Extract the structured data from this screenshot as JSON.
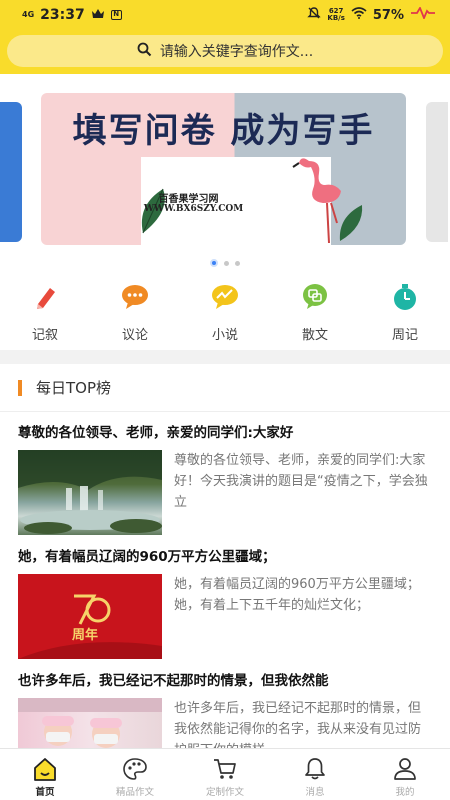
{
  "status_bar": {
    "network": "4G",
    "time": "23:37",
    "speed": "627",
    "speed_unit": "KB/s",
    "battery": "57%",
    "notification_badge": "N"
  },
  "search": {
    "placeholder": "请输入关键字查询作文..."
  },
  "banner": {
    "title": "填写问卷 成为写手",
    "site_name": "百香果学习网",
    "site_url": "WWW.BX6SZY.COM",
    "total_slides": 3,
    "active_slide": 1
  },
  "categories": [
    {
      "label": "记叙",
      "icon": "pencil-icon",
      "color": "#e84a3c"
    },
    {
      "label": "议论",
      "icon": "chat-bubble-icon",
      "color": "#f08a24"
    },
    {
      "label": "小说",
      "icon": "pulse-bubble-icon",
      "color": "#f3c41b"
    },
    {
      "label": "散文",
      "icon": "leaf-bubble-icon",
      "color": "#7cc243"
    },
    {
      "label": "周记",
      "icon": "stopwatch-icon",
      "color": "#1fb5a5"
    }
  ],
  "section": {
    "title": "每日TOP榜"
  },
  "articles": [
    {
      "title": "尊敬的各位领导、老师，亲爱的同学们:大家好",
      "excerpt": "尊敬的各位领导、老师，亲爱的同学们:大家好！今天我演讲的题目是“疫情之下，学会独立",
      "thumb": "waterfall-image"
    },
    {
      "title": "她，有着幅员辽阔的960万平方公里疆域；",
      "excerpt": "她，有着幅员辽阔的960万平方公里疆域；她，有着上下五千年的灿烂文化；",
      "thumb": "70th-anniversary-image",
      "thumb_text": "周年"
    },
    {
      "title": "也许多年后，我已经记不起那时的情景，但我依然能",
      "excerpt": "也许多年后，我已经记不起那时的情景，但我依然能记得你的名字，我从来没有见过防护服下你的模样",
      "thumb": "medical-workers-image"
    }
  ],
  "tabs": [
    {
      "label": "首页",
      "icon": "home-icon",
      "active": true
    },
    {
      "label": "精品作文",
      "icon": "palette-icon",
      "active": false
    },
    {
      "label": "定制作文",
      "icon": "cart-icon",
      "active": false
    },
    {
      "label": "消息",
      "icon": "bell-icon",
      "active": false
    },
    {
      "label": "我的",
      "icon": "user-icon",
      "active": false
    }
  ],
  "colors": {
    "brand_yellow": "#f9dc2b",
    "search_fill": "#fbe98a",
    "accent_orange": "#f08a24",
    "dot_active": "#3b82f6"
  }
}
